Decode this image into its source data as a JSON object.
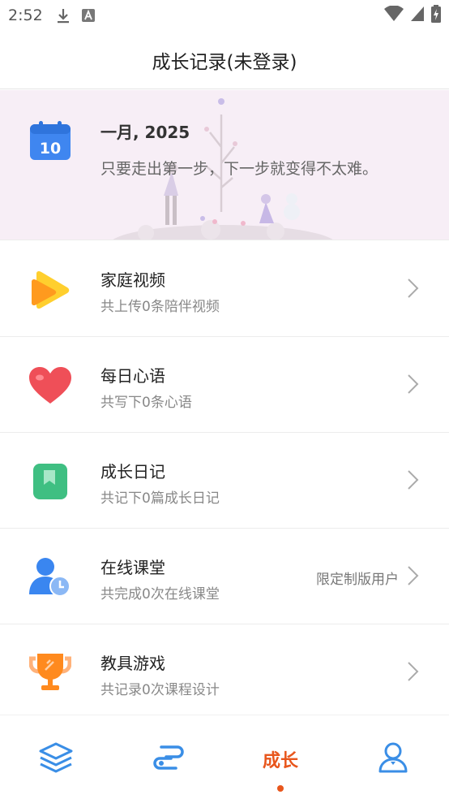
{
  "status_bar": {
    "time": "2:52"
  },
  "header": {
    "title": "成长记录(未登录)"
  },
  "banner": {
    "calendar_day": "10",
    "month": "一月, 2025",
    "quote": "只要走出第一步，下一步就变得不太难。"
  },
  "items": [
    {
      "title": "家庭视频",
      "subtitle": "共上传0条陪伴视频",
      "tag": "",
      "icon": "play-icon"
    },
    {
      "title": "每日心语",
      "subtitle": "共写下0条心语",
      "tag": "",
      "icon": "heart-icon"
    },
    {
      "title": "成长日记",
      "subtitle": "共记下0篇成长日记",
      "tag": "",
      "icon": "bookmark-icon"
    },
    {
      "title": "在线课堂",
      "subtitle": "共完成0次在线课堂",
      "tag": "限定制版用户",
      "icon": "user-clock-icon"
    },
    {
      "title": "教具游戏",
      "subtitle": "共记录0次课程设计",
      "tag": "",
      "icon": "trophy-icon"
    }
  ],
  "tabbar": {
    "active_label": "成长"
  },
  "colors": {
    "accent": "#e8561c",
    "tab_blue": "#3a8ee6"
  }
}
